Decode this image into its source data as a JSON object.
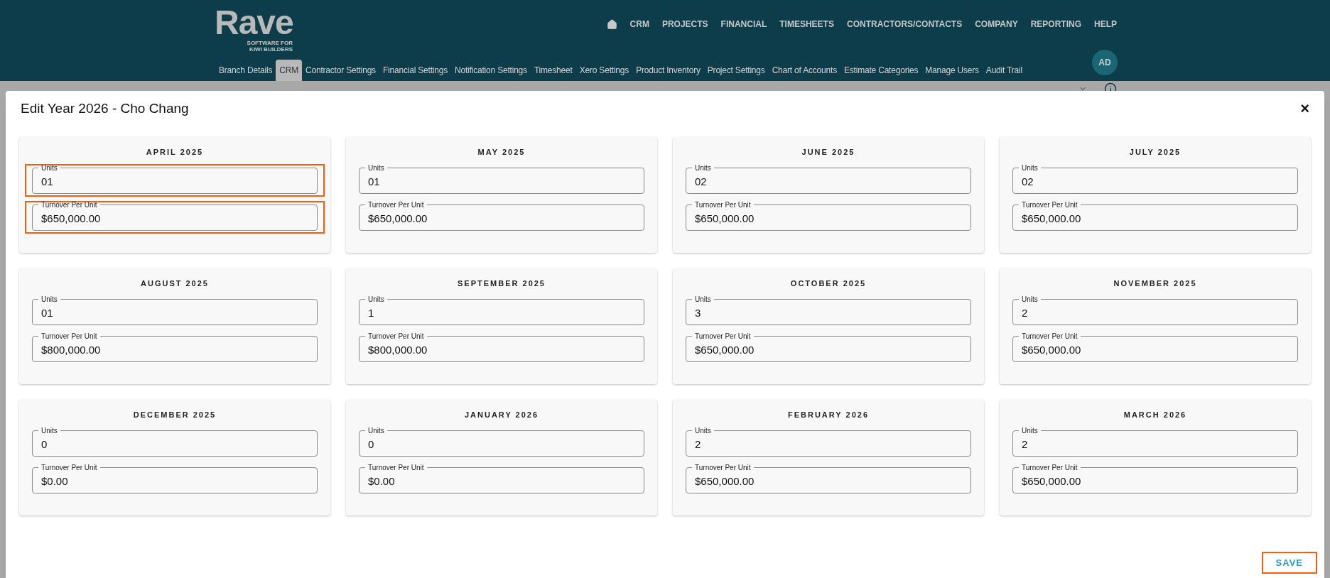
{
  "header": {
    "logo": {
      "name": "Rave",
      "tagline_1": "SOFTWARE FOR",
      "tagline_2": "KIWI BUILDERS"
    },
    "nav": [
      "CRM",
      "PROJECTS",
      "FINANCIAL",
      "TIMESHEETS",
      "CONTRACTORS/CONTACTS",
      "COMPANY",
      "REPORTING",
      "HELP"
    ],
    "tabs": [
      {
        "label": "Branch Details",
        "selected": false
      },
      {
        "label": "CRM",
        "selected": true
      },
      {
        "label": "Contractor Settings",
        "selected": false
      },
      {
        "label": "Financial Settings",
        "selected": false
      },
      {
        "label": "Notification Settings",
        "selected": false
      },
      {
        "label": "Timesheet",
        "selected": false
      },
      {
        "label": "Xero Settings",
        "selected": false
      },
      {
        "label": "Product Inventory",
        "selected": false
      },
      {
        "label": "Project Settings",
        "selected": false
      },
      {
        "label": "Chart of Accounts",
        "selected": false
      },
      {
        "label": "Estimate Categories",
        "selected": false
      },
      {
        "label": "Manage Users",
        "selected": false
      },
      {
        "label": "Audit Trail",
        "selected": false
      }
    ],
    "avatar": "AD"
  },
  "dialog": {
    "title": "Edit Year 2026 - Cho Chang",
    "close": "×",
    "months": [
      {
        "title": "APRIL 2025",
        "fields": [
          {
            "label": "Units",
            "value": "01",
            "highlighted": true
          },
          {
            "label": "Turnover Per Unit",
            "value": "$650,000.00",
            "highlighted": true
          }
        ]
      },
      {
        "title": "MAY 2025",
        "fields": [
          {
            "label": "Units",
            "value": "01",
            "highlighted": false
          },
          {
            "label": "Turnover Per Unit",
            "value": "$650,000.00",
            "highlighted": false
          }
        ]
      },
      {
        "title": "JUNE 2025",
        "fields": [
          {
            "label": "Units",
            "value": "02",
            "highlighted": false
          },
          {
            "label": "Turnover Per Unit",
            "value": "$650,000.00",
            "highlighted": false
          }
        ]
      },
      {
        "title": "JULY 2025",
        "fields": [
          {
            "label": "Units",
            "value": "02",
            "highlighted": false
          },
          {
            "label": "Turnover Per Unit",
            "value": "$650,000.00",
            "highlighted": false
          }
        ]
      },
      {
        "title": "AUGUST 2025",
        "fields": [
          {
            "label": "Units",
            "value": "01",
            "highlighted": false
          },
          {
            "label": "Turnover Per Unit",
            "value": "$800,000.00",
            "highlighted": false
          }
        ]
      },
      {
        "title": "SEPTEMBER 2025",
        "fields": [
          {
            "label": "Units",
            "value": "1",
            "highlighted": false
          },
          {
            "label": "Turnover Per Unit",
            "value": "$800,000.00",
            "highlighted": false
          }
        ]
      },
      {
        "title": "OCTOBER 2025",
        "fields": [
          {
            "label": "Units",
            "value": "3",
            "highlighted": false
          },
          {
            "label": "Turnover Per Unit",
            "value": "$650,000.00",
            "highlighted": false
          }
        ]
      },
      {
        "title": "NOVEMBER 2025",
        "fields": [
          {
            "label": "Units",
            "value": "2",
            "highlighted": false
          },
          {
            "label": "Turnover Per Unit",
            "value": "$650,000.00",
            "highlighted": false
          }
        ]
      },
      {
        "title": "DECEMBER 2025",
        "fields": [
          {
            "label": "Units",
            "value": "0",
            "highlighted": false
          },
          {
            "label": "Turnover Per Unit",
            "value": "$0.00",
            "highlighted": false
          }
        ]
      },
      {
        "title": "JANUARY 2026",
        "fields": [
          {
            "label": "Units",
            "value": "0",
            "highlighted": false
          },
          {
            "label": "Turnover Per Unit",
            "value": "$0.00",
            "highlighted": false
          }
        ]
      },
      {
        "title": "FEBRUARY 2026",
        "fields": [
          {
            "label": "Units",
            "value": "2",
            "highlighted": false
          },
          {
            "label": "Turnover Per Unit",
            "value": "$650,000.00",
            "highlighted": false
          }
        ]
      },
      {
        "title": "MARCH 2026",
        "fields": [
          {
            "label": "Units",
            "value": "2",
            "highlighted": false
          },
          {
            "label": "Turnover Per Unit",
            "value": "$650,000.00",
            "highlighted": false
          }
        ]
      }
    ],
    "save": {
      "label": "SAVE",
      "highlighted": true
    }
  }
}
